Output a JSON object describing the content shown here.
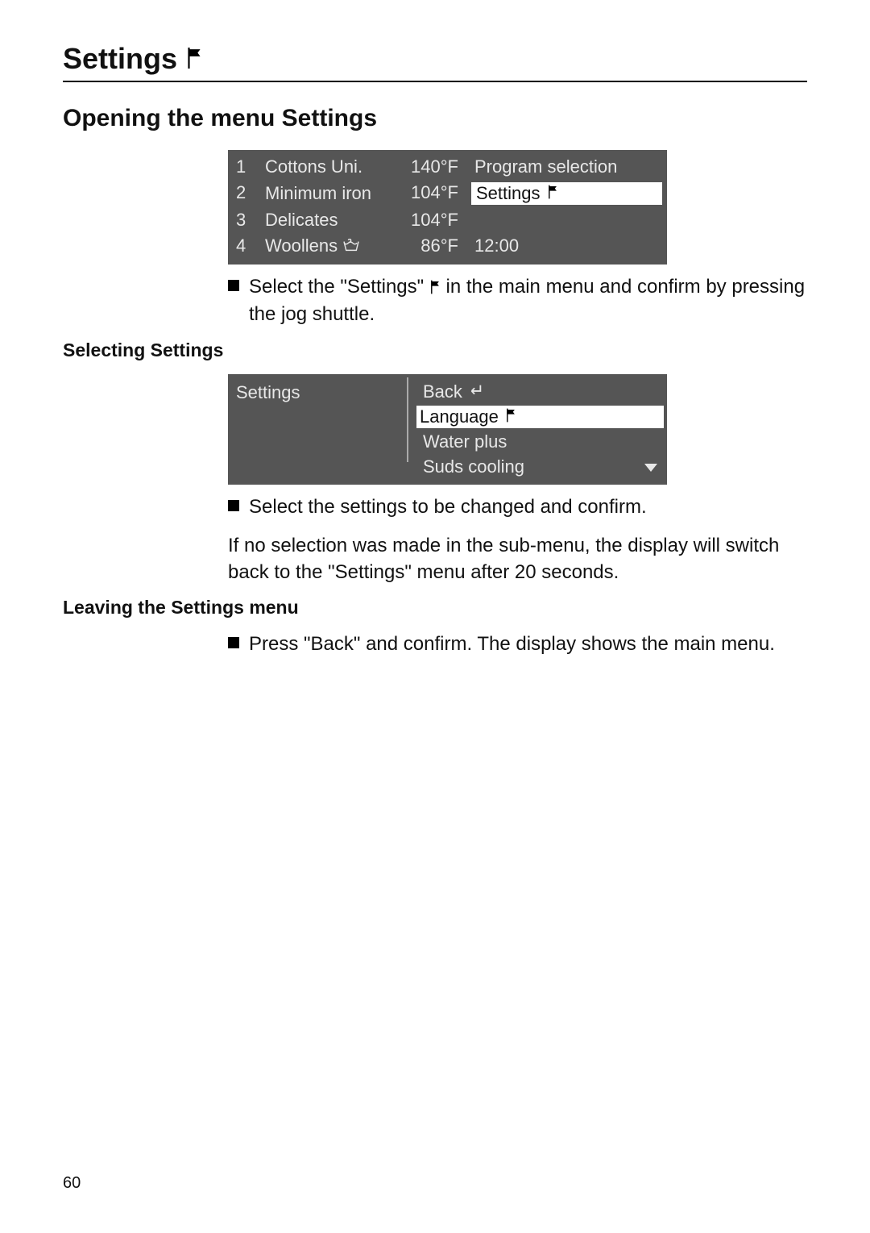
{
  "header": {
    "title": "Settings"
  },
  "section1": {
    "title": "Opening the menu Settings",
    "bullet_text_a": "Select the \"Settings\" ",
    "bullet_text_b": " in the main menu and confirm by pressing the jog shuttle."
  },
  "lcd1": {
    "rows": [
      {
        "num": "1",
        "prog": "Cottons Uni.",
        "temp": "140°F",
        "hand": false
      },
      {
        "num": "2",
        "prog": "Minimum iron",
        "temp": "104°F",
        "hand": false
      },
      {
        "num": "3",
        "prog": "Delicates",
        "temp": "104°F",
        "hand": false
      },
      {
        "num": "4",
        "prog": "Woollens",
        "temp": "86°F",
        "hand": true
      }
    ],
    "side_top": "Program selection",
    "side_selected": "Settings",
    "side_time": "12:00"
  },
  "section2": {
    "heading": "Selecting Settings",
    "bullet_text": "Select the settings to be changed and confirm.",
    "para": "If no selection was made in the sub-menu, the display will switch back to the \"Settings\" menu after 20 seconds."
  },
  "lcd2": {
    "left_title": "Settings",
    "back_label": "Back",
    "options": [
      {
        "label": "Language",
        "flag": true,
        "selected": true
      },
      {
        "label": "Water plus",
        "flag": false,
        "selected": false
      },
      {
        "label": "Suds cooling",
        "flag": false,
        "selected": false
      }
    ]
  },
  "section3": {
    "heading": "Leaving the Settings menu",
    "bullet_text": "Press \"Back\" and confirm. The display shows the main menu."
  },
  "page_number": "60"
}
